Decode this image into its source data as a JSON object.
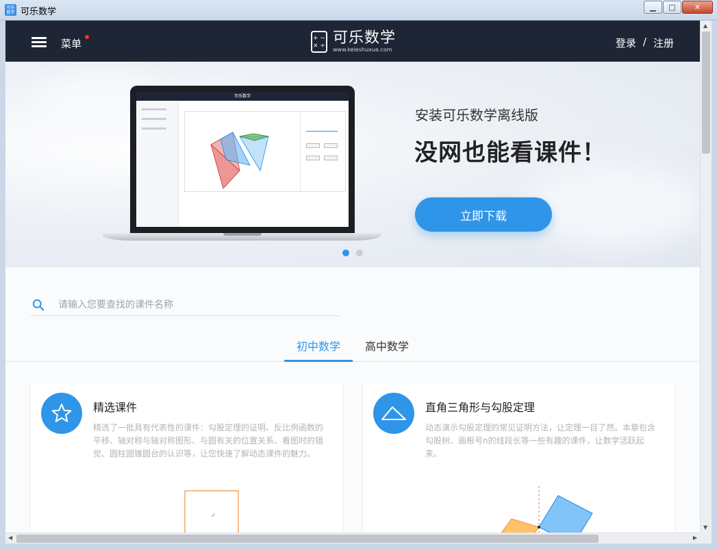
{
  "window": {
    "title": "可乐数学",
    "icon_text": "可乐数学"
  },
  "header": {
    "menu_label": "菜单",
    "logo_name": "可乐数学",
    "logo_url": "www.keleshuxue.com",
    "logo_icon_glyphs": "+ −\n× ÷",
    "login": "登录",
    "separator": "/",
    "register": "注册"
  },
  "banner": {
    "subtitle": "安装可乐数学离线版",
    "title": "没网也能看课件！",
    "download_button": "立即下载",
    "slide_count": 2,
    "active_slide": 1,
    "screen_title": "可乐数学"
  },
  "search": {
    "placeholder": "请输入您要查找的课件名称",
    "value": ""
  },
  "tabs": [
    {
      "label": "初中数学",
      "active": true
    },
    {
      "label": "高中数学",
      "active": false
    }
  ],
  "cards": [
    {
      "title": "精选课件",
      "icon": "star-icon",
      "description": "精选了一批具有代表性的课件：勾股定理的证明、反比例函数的平移、轴对称与轴对称图形、与圆有关的位置关系、看图时的错觉、圆柱圆锥圆台的认识等，让您快速了解动态课件的魅力。"
    },
    {
      "title": "直角三角形与勾股定理",
      "icon": "triangle-icon",
      "description": "动态演示勾股定理的常见证明方法，让定理一目了然。本章包含勾股树、画根号n的线段长等一些有趣的课件，让数学活跃起来。"
    }
  ],
  "colors": {
    "accent": "#2f95e8",
    "header_bg": "#1e2535",
    "notification_dot": "#ff2d2d"
  },
  "window_buttons": {
    "minimize": "▁",
    "maximize": "□",
    "close": "✕"
  }
}
